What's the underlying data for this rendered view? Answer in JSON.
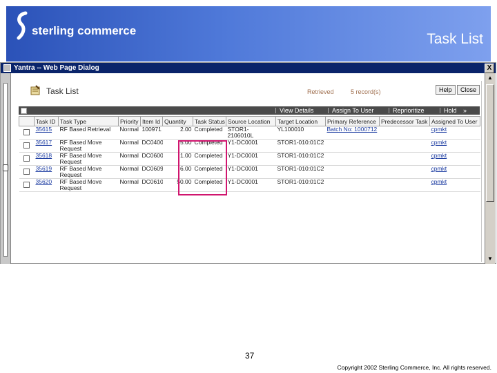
{
  "slide": {
    "logo_text": "sterling commerce",
    "title": "Task List",
    "page_number": "37",
    "copyright": "Copyright 2002 Sterling Commerce, Inc. All rights reserved.",
    "banner_color": "#3a63c8",
    "highlight_color": "#d0156e"
  },
  "dialog": {
    "title": "Yantra -- Web Page Dialog",
    "close_label": "X"
  },
  "task_list": {
    "title": "Task List",
    "retrieved_label": "Retrieved",
    "records_label": "5 record(s)",
    "help_label": "Help",
    "close_label": "Close"
  },
  "actions": {
    "view_details": "View Details",
    "assign_to_user": "Assign To User",
    "reprioritize": "Reprioritize",
    "hold": "Hold",
    "more": "»"
  },
  "table": {
    "columns": [
      "Task ID",
      "Task Type",
      "Priority",
      "Item Id",
      "Quantity",
      "Task Status",
      "Source Location",
      "Target Location",
      "Primary Reference",
      "Predecessor Task",
      "Assigned To User"
    ],
    "rows": [
      {
        "task_id": "35615",
        "task_type": "RF Based Retrieval",
        "priority": "Normal",
        "item_id": "100971",
        "quantity": "2.00",
        "task_status": "Completed",
        "source_location": "STOR1-2106010L",
        "target_location": "YL100010",
        "primary_reference": "Batch No: 1000712",
        "predecessor_task": "",
        "assigned_to_user": "cpmkt"
      },
      {
        "task_id": "35617",
        "task_type": "RF Based Move Request",
        "priority": "Normal",
        "item_id": "DC0400",
        "quantity": "5.00",
        "task_status": "Completed",
        "source_location": "Y1-DC0001",
        "target_location": "STOR1-010:01C2",
        "primary_reference": "",
        "predecessor_task": "",
        "assigned_to_user": "cpmkt"
      },
      {
        "task_id": "35618",
        "task_type": "RF Based Move Request",
        "priority": "Normal",
        "item_id": "DC0600",
        "quantity": "1.00",
        "task_status": "Completed",
        "source_location": "Y1-DC0001",
        "target_location": "STOR1-010:01C2",
        "primary_reference": "",
        "predecessor_task": "",
        "assigned_to_user": "cpmkt"
      },
      {
        "task_id": "35619",
        "task_type": "RF Based Move Request",
        "priority": "Normal",
        "item_id": "DC0609",
        "quantity": "6.00",
        "task_status": "Completed",
        "source_location": "Y1-DC0001",
        "target_location": "STOR1-010:01C2",
        "primary_reference": "",
        "predecessor_task": "",
        "assigned_to_user": "cpmkt"
      },
      {
        "task_id": "35620",
        "task_type": "RF Based Move Request",
        "priority": "Normal",
        "item_id": "DC0610",
        "quantity": "50.00",
        "task_status": "Completed",
        "source_location": "Y1-DC0001",
        "target_location": "STOR1-010:01C2",
        "primary_reference": "",
        "predecessor_task": "",
        "assigned_to_user": "cpmkt"
      }
    ]
  }
}
